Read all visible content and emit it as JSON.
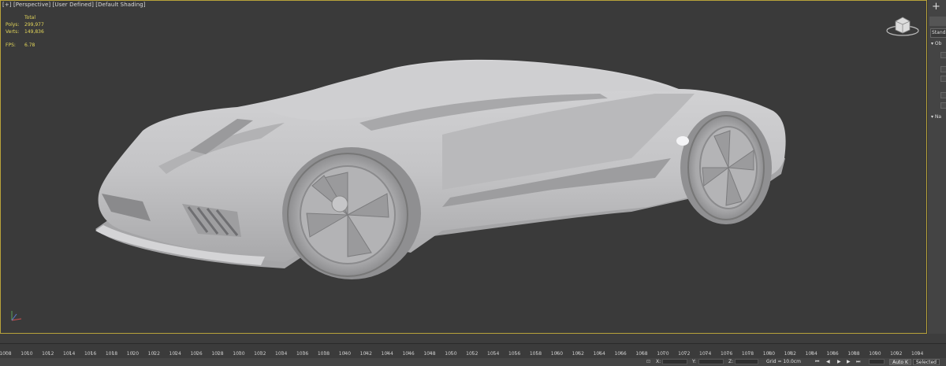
{
  "viewport": {
    "label": "[+] [Perspective] [User Defined] [Default Shading]",
    "stats": {
      "total_label": "Total",
      "polys_label": "Polys:",
      "polys_value": "299,977",
      "verts_label": "Verts:",
      "verts_value": "149,836",
      "fps_label": "FPS:",
      "fps_value": "6.78"
    },
    "icons": {
      "viewcube": "viewcube-icon",
      "axis": "axis-gizmo-icon"
    }
  },
  "command_panel": {
    "add_label": "+",
    "dropdown_value": "Standa",
    "rollout_object": "Ob",
    "rollout_name": "Na"
  },
  "timeline": {
    "frames": [
      "1008",
      "1010",
      "1012",
      "1014",
      "1016",
      "1018",
      "1020",
      "1022",
      "1024",
      "1026",
      "1028",
      "1030",
      "1032",
      "1034",
      "1036",
      "1038",
      "1040",
      "1042",
      "1044",
      "1046",
      "1048",
      "1050",
      "1052",
      "1054",
      "1056",
      "1058",
      "1060",
      "1062",
      "1064",
      "1066",
      "1068",
      "1070",
      "1072",
      "1074",
      "1076",
      "1078",
      "1080",
      "1082",
      "1084",
      "1086",
      "1088",
      "1090",
      "1092",
      "1094"
    ]
  },
  "statusbar": {
    "x_label": "X:",
    "y_label": "Y:",
    "z_label": "Z:",
    "grid_text": "Grid = 10.0cm",
    "auto_key": "Auto K",
    "selected": "Selected"
  },
  "colors": {
    "viewport_bg": "#3a3a3a",
    "viewport_border": "#b8a23a",
    "stats_text": "#e3d65a",
    "car_body": "#c9c9cb"
  }
}
